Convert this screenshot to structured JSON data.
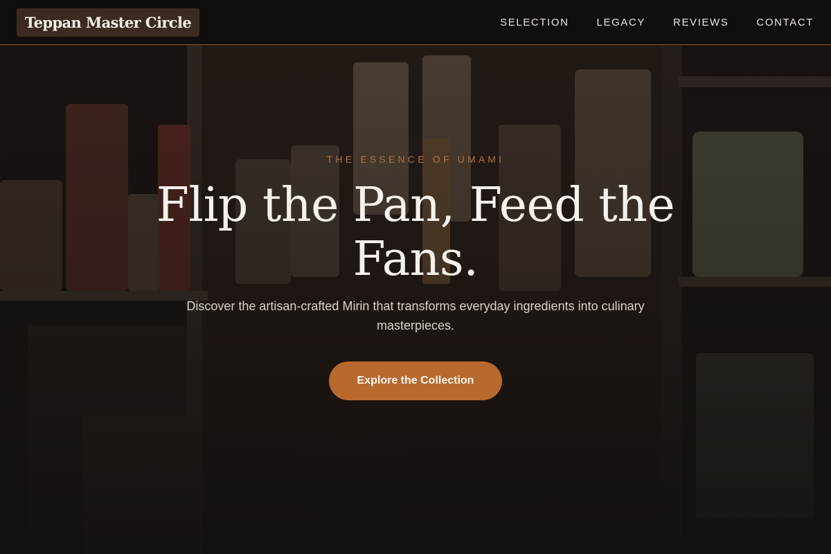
{
  "brand": {
    "name": "Teppan Master Circle"
  },
  "nav": {
    "items": [
      {
        "label": "SELECTION"
      },
      {
        "label": "LEGACY"
      },
      {
        "label": "REVIEWS"
      },
      {
        "label": "CONTACT"
      }
    ]
  },
  "hero": {
    "eyebrow": "THE ESSENCE OF UMAMI",
    "headline": "Flip the Pan, Feed the Fans.",
    "subtext": "Discover the artisan-crafted Mirin that transforms everyday ingredients into culinary masterpieces.",
    "cta_label": "Explore the Collection"
  },
  "colors": {
    "accent": "#b8692e",
    "eyebrow": "#b8703a",
    "nav_border": "#8a5a34",
    "brand_bg": "#3b2a1d",
    "background": "#141210"
  }
}
